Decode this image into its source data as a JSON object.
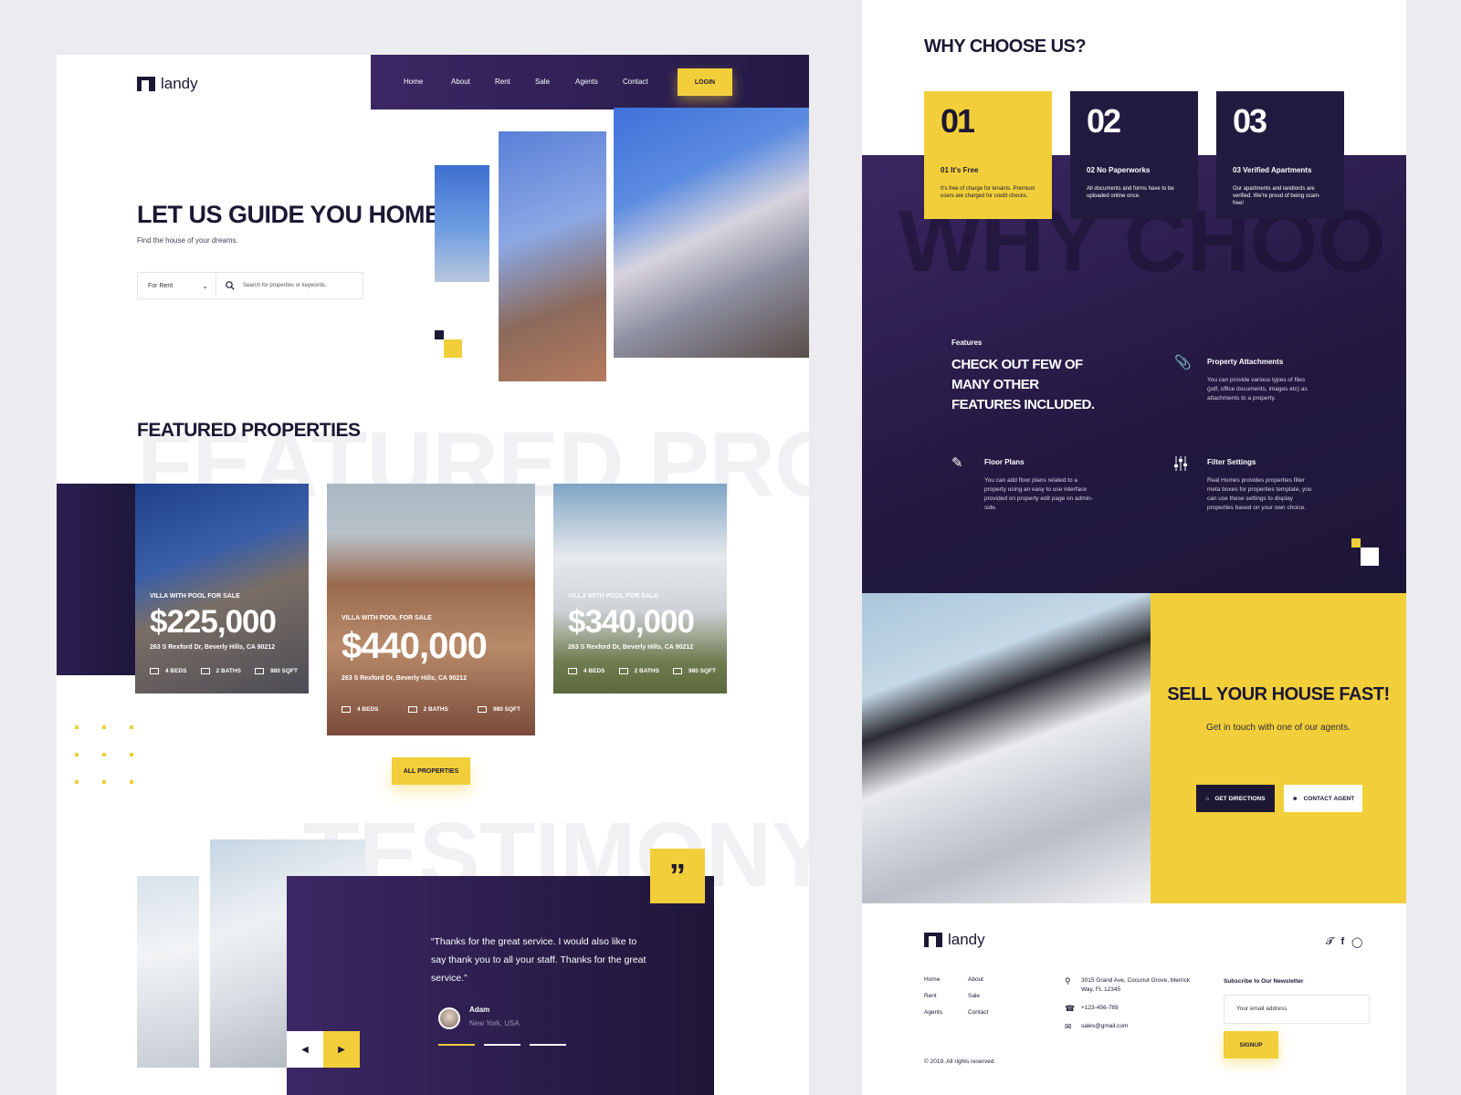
{
  "left": {
    "logo_text": "landy",
    "nav": [
      "Home",
      "About",
      "Rent",
      "Sale",
      "Agents",
      "Contact"
    ],
    "login": "LOGIN",
    "hero": {
      "title": "LET US GUIDE YOU HOME",
      "subtitle": "Find the house of your dreams.",
      "select_value": "For Rent",
      "search_placeholder": "Search for properties or keywords."
    },
    "featured": {
      "bg_text": "FEATURED PRO",
      "title": "FEATURED PROPERTIES",
      "cards": [
        {
          "tag": "VILLA WITH POOL FOR SALE",
          "price": "$225,000",
          "address": "263 S Rexford Dr, Beverly Hills, CA 90212",
          "beds": "4 BEDS",
          "baths": "2 BATHS",
          "area": "980 SQFT"
        },
        {
          "tag": "VILLA WITH POOL FOR SALE",
          "price": "$440,000",
          "address": "263 S Rexford Dr, Beverly Hills, CA 90212",
          "beds": "4 BEDS",
          "baths": "2 BATHS",
          "area": "980 SQFT"
        },
        {
          "tag": "VILLA WITH POOL FOR SALE",
          "price": "$340,000",
          "address": "263 S Rexford Dr, Beverly Hills, CA 90212",
          "beds": "4 BEDS",
          "baths": "2 BATHS",
          "area": "980 SQFT"
        }
      ],
      "all_button": "ALL PROPERTIES"
    },
    "testimony": {
      "bg_text": "TESTIMONY",
      "quote_mark": "”",
      "text": "“Thanks for the great service. I would also like to say thank you to all your staff. Thanks for the great service.”",
      "author": "Adam",
      "location": "New York, USA"
    }
  },
  "right": {
    "why": {
      "title": "WHY CHOOSE US?",
      "bg_text": "WHY CHOO",
      "cards": [
        {
          "num": "01",
          "title": "01 It's Free",
          "desc": "It's free of charge for tenants. Premium users are charged for credit checks."
        },
        {
          "num": "02",
          "title": "02 No Paperworks",
          "desc": "All documents and forms have to be uploaded online once."
        },
        {
          "num": "03",
          "title": "03 Verified Apartments",
          "desc": "Our apartments and landlords are verified. We're proud of being scam-free!"
        }
      ]
    },
    "features": {
      "label": "Features",
      "heading": "CHECK OUT FEW OF MANY OTHER FEATURES INCLUDED.",
      "items": [
        {
          "title": "Property Attachments",
          "desc": "You can provide various types of files (pdf, office documents, images etc) as attachments to a property."
        },
        {
          "title": "Floor Plans",
          "desc": "You can add floor plans related to a property using an easy to use interface provided on property edit page on admin-side."
        },
        {
          "title": "Filter Settings",
          "desc": "Real Homes provides properties filter meta boxes for properties template, you can use these settings to display properties based on your own choice."
        }
      ]
    },
    "sell": {
      "title": "SELL YOUR HOUSE FAST!",
      "subtitle": "Get in touch with one of our agents.",
      "btn_directions": "GET DIRECTIONS",
      "btn_contact": "CONTACT AGENT"
    },
    "footer": {
      "logo_text": "landy",
      "links": [
        "Home",
        "About",
        "Rent",
        "Sale",
        "Agents",
        "Contact"
      ],
      "address": "3015 Grand Ave, Cocunut Grove, Merrick Way, FL 12345",
      "phone": "+123-456-789",
      "email": "sales@gmail.com",
      "newsletter_title": "Subscribe to Our Newsletter",
      "newsletter_placeholder": "Your email address",
      "signup": "SIGNUP",
      "copyright": "© 2019. All rights reserved."
    }
  },
  "colors": {
    "accent": "#f2cf3a",
    "dark": "#1c1733",
    "purple": "#3b2764"
  }
}
